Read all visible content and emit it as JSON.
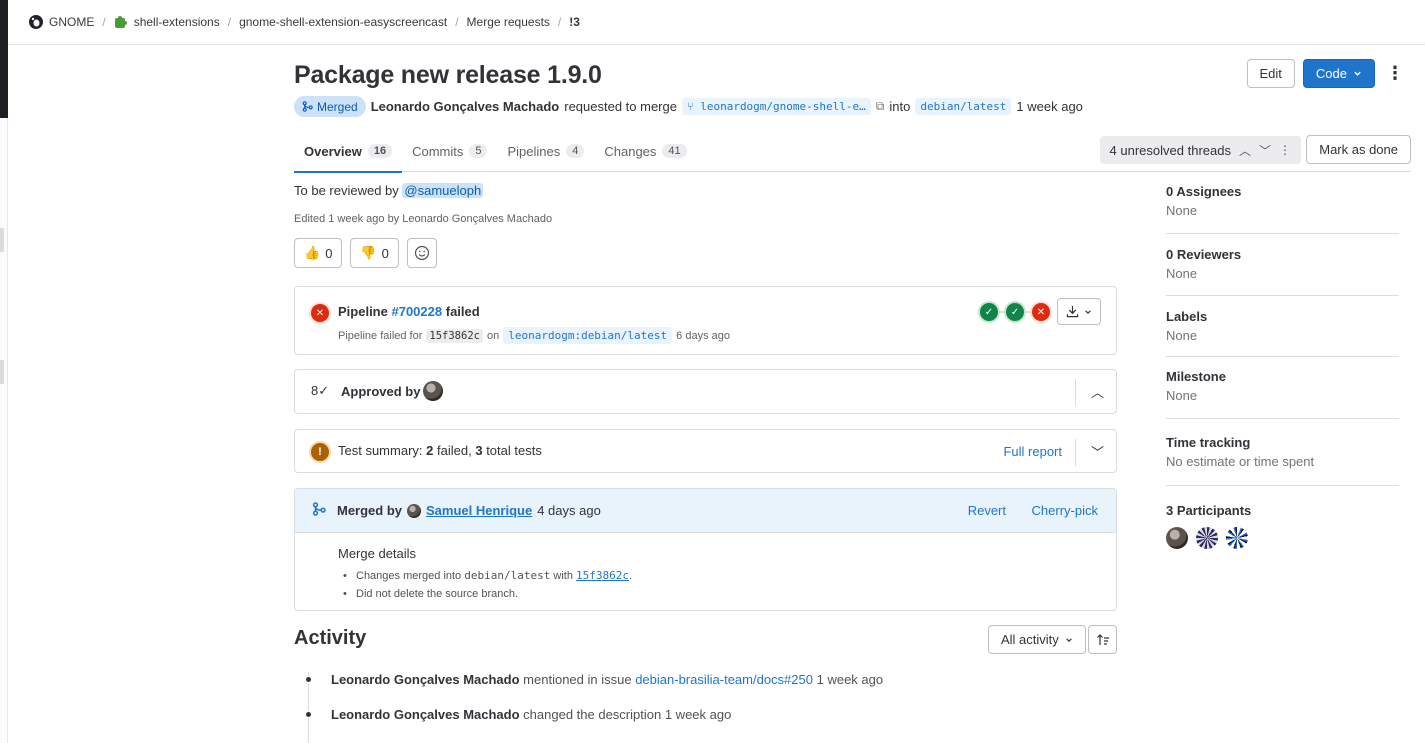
{
  "breadcrumb": {
    "items": [
      "GNOME",
      "shell-extensions",
      "gnome-shell-extension-easyscreencast",
      "Merge requests",
      "!3"
    ]
  },
  "header": {
    "title": "Package new release 1.9.0",
    "edit_label": "Edit",
    "code_label": "Code",
    "status_badge": "Merged",
    "author": "Leonardo Gonçalves Machado",
    "requested_text": "requested to merge",
    "source_branch": "leonardogm/gnome-shell-e…",
    "into_text": "into",
    "target_branch": "debian/latest",
    "time": "1 week ago"
  },
  "tabs": [
    {
      "label": "Overview",
      "count": "16"
    },
    {
      "label": "Commits",
      "count": "5"
    },
    {
      "label": "Pipelines",
      "count": "4"
    },
    {
      "label": "Changes",
      "count": "41"
    }
  ],
  "threads": {
    "label": "4 unresolved threads",
    "mark_done": "Mark as done"
  },
  "description": {
    "prefix": "To be reviewed by",
    "mention": "@samueloph",
    "edited": "Edited 1 week ago by Leonardo Gonçalves Machado"
  },
  "reactions": {
    "thumbs_up_count": "0",
    "thumbs_down_count": "0"
  },
  "pipeline": {
    "title_prefix": "Pipeline",
    "id": "#700228",
    "title_suffix": "failed",
    "sub_prefix": "Pipeline failed for",
    "sha": "15f3862c",
    "on_text": "on",
    "ref": "leonardogm:debian/latest",
    "time": "6 days ago"
  },
  "approval": {
    "label": "Approved by"
  },
  "test_summary": {
    "prefix": "Test summary:",
    "failed": "2",
    "failed_text": "failed,",
    "total": "3",
    "total_text": "total tests",
    "full_report": "Full report"
  },
  "merged": {
    "prefix": "Merged by",
    "user": "Samuel Henrique",
    "time": "4 days ago",
    "revert": "Revert",
    "cherry_pick": "Cherry-pick",
    "details_title": "Merge details",
    "line1_prefix": "Changes merged into",
    "line1_branch": "debian/latest",
    "line1_with": "with",
    "line1_sha": "15f3862c",
    "line2": "Did not delete the source branch."
  },
  "activity": {
    "title": "Activity",
    "filter": "All activity",
    "entries": [
      {
        "author": "Leonardo Gonçalves Machado",
        "action": "mentioned in issue",
        "link": "debian-brasilia-team/docs#250",
        "time": "1 week ago"
      },
      {
        "author": "Leonardo Gonçalves Machado",
        "action": "changed the description",
        "time": "1 week ago"
      }
    ]
  },
  "sidebar": {
    "assignees_title": "0 Assignees",
    "assignees_value": "None",
    "reviewers_title": "0 Reviewers",
    "reviewers_value": "None",
    "labels_title": "Labels",
    "labels_value": "None",
    "milestone_title": "Milestone",
    "milestone_value": "None",
    "time_tracking_title": "Time tracking",
    "time_tracking_value": "No estimate or time spent",
    "participants_title": "3 Participants"
  },
  "colors": {
    "accent": "#1f75cb",
    "merged_badge_bg": "#cbe2f9",
    "failed": "#dd2b0e",
    "success": "#108548",
    "warning": "#ab6100"
  }
}
